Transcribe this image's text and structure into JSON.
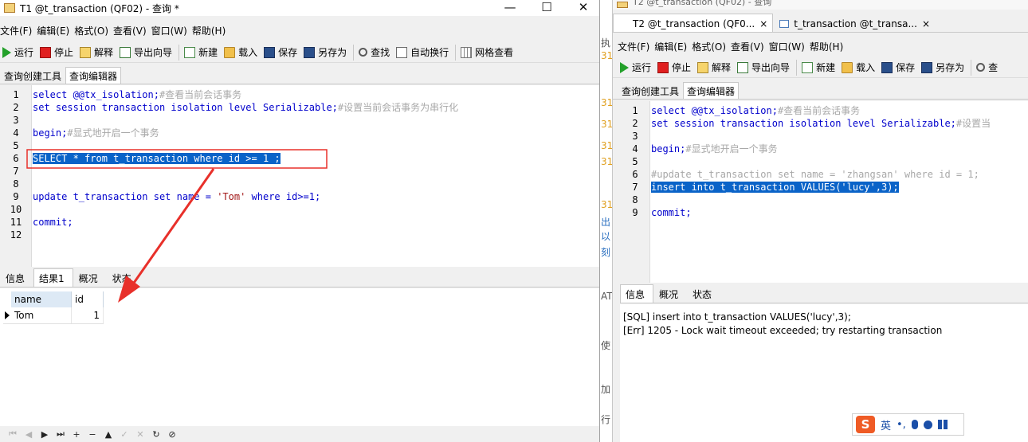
{
  "window1": {
    "title": "T1 @t_transaction (QF02) - 查询 *",
    "controls": [
      "—",
      "☐",
      "✕"
    ],
    "menu": [
      "文件(F)",
      "编辑(E)",
      "格式(O)",
      "查看(V)",
      "窗口(W)",
      "帮助(H)"
    ],
    "toolbar": {
      "run": "运行",
      "stop": "停止",
      "explain": "解释",
      "export": "导出向导",
      "new": "新建",
      "load": "载入",
      "save": "保存",
      "save_as": "另存为",
      "find": "查找",
      "wrap": "自动换行",
      "grid": "网格查看"
    },
    "subtabs": [
      "查询创建工具",
      "查询编辑器"
    ],
    "code_lines": [
      {
        "num": "1",
        "tokens": [
          {
            "t": "select",
            "c": "kw"
          },
          {
            "t": " @@tx_isolation;",
            "c": "kw"
          },
          {
            "t": "#查看当前会话事务",
            "c": "cm"
          }
        ]
      },
      {
        "num": "2",
        "tokens": [
          {
            "t": "set session transaction isolation level Serializable;",
            "c": "kw"
          },
          {
            "t": "#设置当前会话事务为串行化",
            "c": "cm"
          }
        ]
      },
      {
        "num": "3",
        "tokens": []
      },
      {
        "num": "4",
        "tokens": [
          {
            "t": "begin;",
            "c": "kw"
          },
          {
            "t": "#显式地开启一个事务",
            "c": "cm"
          }
        ]
      },
      {
        "num": "5",
        "tokens": []
      },
      {
        "num": "6",
        "tokens": [
          {
            "t": "SELECT * from t_transaction where id >= 1 ;",
            "c": "sel"
          }
        ]
      },
      {
        "num": "7",
        "tokens": []
      },
      {
        "num": "8",
        "tokens": []
      },
      {
        "num": "9",
        "tokens": [
          {
            "t": "update t_transaction set name = ",
            "c": "kw"
          },
          {
            "t": "'Tom'",
            "c": "str"
          },
          {
            "t": " where id>=1;",
            "c": "kw"
          }
        ]
      },
      {
        "num": "10",
        "tokens": []
      },
      {
        "num": "11",
        "tokens": [
          {
            "t": "commit;",
            "c": "kw"
          }
        ]
      },
      {
        "num": "12",
        "tokens": []
      }
    ],
    "result_tabs": [
      "信息",
      "结果1",
      "概况",
      "状态"
    ],
    "result_columns": [
      "name",
      "id"
    ],
    "result_rows": [
      [
        "Tom",
        "1"
      ]
    ],
    "status_buttons": [
      "⏮",
      "◀",
      "▶",
      "⏭",
      "+",
      "−",
      "▲",
      "✓",
      "✕",
      "↻",
      "⊘"
    ]
  },
  "gap_text": [
    "执",
    "31",
    "31",
    "31",
    "31",
    "31",
    "31",
    "出",
    "以",
    "刻",
    "AT",
    "使",
    "加",
    "行"
  ],
  "window2": {
    "title_partial": "T2 @t_transaction (QF02) - 查询",
    "tabs": [
      {
        "label": "T2 @t_transaction (QF0..."
      },
      {
        "label": "t_transaction @t_transa..."
      }
    ],
    "tab_close": "×",
    "menu": [
      "文件(F)",
      "编辑(E)",
      "格式(O)",
      "查看(V)",
      "窗口(W)",
      "帮助(H)"
    ],
    "toolbar": {
      "run": "运行",
      "stop": "停止",
      "explain": "解释",
      "export": "导出向导",
      "new": "新建",
      "load": "载入",
      "save": "保存",
      "save_as": "另存为",
      "find": "查"
    },
    "subtabs": [
      "查询创建工具",
      "查询编辑器"
    ],
    "code_lines": [
      {
        "num": "1",
        "tokens": [
          {
            "t": "select @@tx_isolation;",
            "c": "kw"
          },
          {
            "t": "#查看当前会话事务",
            "c": "cm"
          }
        ]
      },
      {
        "num": "2",
        "tokens": [
          {
            "t": "set session transaction isolation level Serializable;",
            "c": "kw"
          },
          {
            "t": "#设置当",
            "c": "cm"
          }
        ]
      },
      {
        "num": "3",
        "tokens": []
      },
      {
        "num": "4",
        "tokens": [
          {
            "t": "begin;",
            "c": "kw"
          },
          {
            "t": "#显式地开启一个事务",
            "c": "cm"
          }
        ]
      },
      {
        "num": "5",
        "tokens": []
      },
      {
        "num": "6",
        "tokens": [
          {
            "t": "#update t_transaction set name = 'zhangsan' where id = 1;",
            "c": "cm"
          }
        ]
      },
      {
        "num": "7",
        "tokens": [
          {
            "t": "insert into t_transaction VALUES('lucy',3);",
            "c": "sel"
          }
        ]
      },
      {
        "num": "8",
        "tokens": []
      },
      {
        "num": "9",
        "tokens": [
          {
            "t": "commit;",
            "c": "kw"
          }
        ]
      }
    ],
    "result_tabs": [
      "信息",
      "概况",
      "状态"
    ],
    "messages": [
      "[SQL] insert into t_transaction VALUES('lucy',3);",
      "[Err] 1205 - Lock wait timeout exceeded; try restarting transaction"
    ]
  },
  "ime": {
    "logo": "S",
    "lang": "英",
    "icons": [
      "•,",
      "mic-icon",
      "user-icon",
      "grid-icon"
    ]
  },
  "colors": {
    "keyword": "#0000cc",
    "comment": "#a8a8a8",
    "selection": "#0a63c8",
    "annotation": "#e8302a"
  }
}
